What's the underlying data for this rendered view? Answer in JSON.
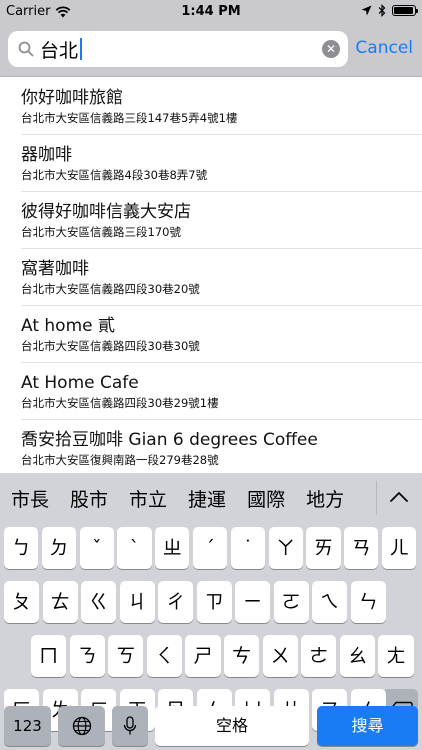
{
  "status_bar": {
    "carrier": "Carrier",
    "time": "1:44 PM",
    "battery_level": 0.95
  },
  "search": {
    "query": "台北",
    "cancel_label": "Cancel"
  },
  "results": [
    {
      "name": "你好咖啡旅館",
      "address": "台北市大安區信義路三段147巷5弄4號1樓"
    },
    {
      "name": "器咖啡",
      "address": "台北市大安區信義路4段30巷8弄7號"
    },
    {
      "name": "彼得好咖啡信義大安店",
      "address": "台北市大安區信義路三段170號"
    },
    {
      "name": "窩著咖啡",
      "address": "台北市大安區信義路四段30巷20號"
    },
    {
      "name": "At home 貳",
      "address": "台北市大安區信義路四段30巷30號"
    },
    {
      "name": "At Home Cafe",
      "address": "台北市大安區信義路四段30巷29號1樓"
    },
    {
      "name": "喬安拾豆咖啡 Gian 6 degrees Coffee",
      "address": "台北市大安區復興南路一段279巷28號"
    }
  ],
  "keyboard": {
    "candidates": [
      "市長",
      "股市",
      "市立",
      "捷運",
      "國際",
      "地方"
    ],
    "rows": [
      [
        "ㄅ",
        "ㄉ",
        "ˇ",
        "ˋ",
        "ㄓ",
        "ˊ",
        "˙",
        "ㄚ",
        "ㄞ",
        "ㄢ",
        "ㄦ"
      ],
      [
        "ㄆ",
        "ㄊ",
        "ㄍ",
        "ㄐ",
        "ㄔ",
        "ㄗ",
        "ㄧ",
        "ㄛ",
        "ㄟ",
        "ㄣ"
      ],
      [
        "ㄇ",
        "ㄋ",
        "ㄎ",
        "ㄑ",
        "ㄕ",
        "ㄘ",
        "ㄨ",
        "ㄜ",
        "ㄠ",
        "ㄤ"
      ],
      [
        "ㄈ",
        "ㄌ",
        "ㄏ",
        "ㄒ",
        "ㄖ",
        "ㄙ",
        "ㄩ",
        "ㄝ",
        "ㄡ",
        "ㄥ"
      ]
    ],
    "numbers_label": "123",
    "space_label": "空格",
    "search_label": "搜尋"
  }
}
